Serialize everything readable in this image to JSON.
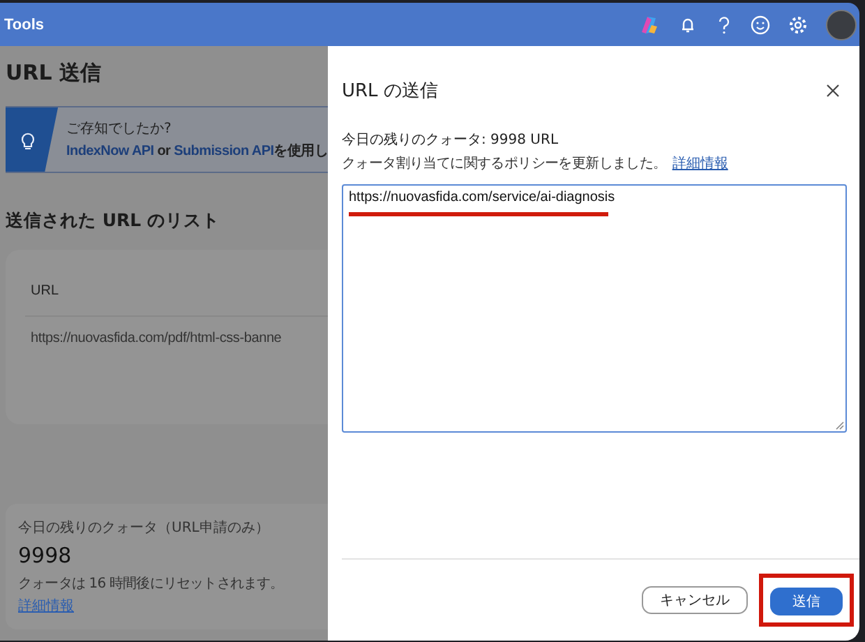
{
  "top_bar": {
    "title": "Tools"
  },
  "page": {
    "title": "URL 送信",
    "tip": {
      "heading": "ご存知でしたか?",
      "parts": [
        {
          "kind": "link",
          "text": "IndexNow API"
        },
        {
          "kind": "text",
          "text": " or "
        },
        {
          "kind": "link",
          "text": "Submission API"
        },
        {
          "kind": "text",
          "text": "を使用し"
        }
      ]
    },
    "list_title": "送信された URL のリスト",
    "table": {
      "columns": [
        "URL"
      ],
      "rows": [
        [
          "https://nuovasfida.com/pdf/html-css-banne"
        ]
      ]
    },
    "quota_card": {
      "label": "今日の残りのクォータ（URL申請のみ）",
      "value": "9998",
      "note": "クォータは 16 時間後にリセットされます。",
      "link": "詳細情報"
    }
  },
  "dialog": {
    "title": "URL の送信",
    "quota": "今日の残りのクォータ: 9998 URL",
    "policy": "クォータ割り当てに関するポリシーを更新しました。",
    "policy_link": "詳細情報",
    "url_value": "https://nuovasfida.com/service/ai-diagnosis",
    "buttons": [
      {
        "label": "キャンセル",
        "kind": "secondary"
      },
      {
        "label": "送信",
        "kind": "primary"
      }
    ]
  }
}
